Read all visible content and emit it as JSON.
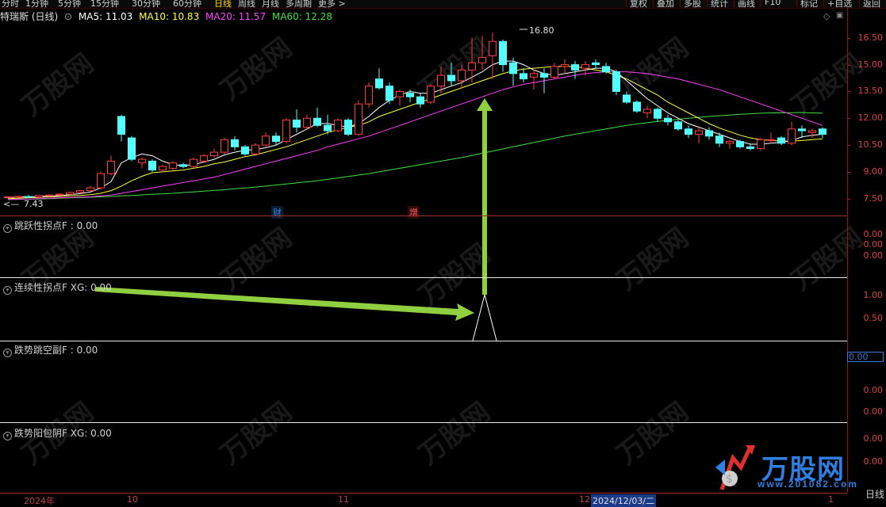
{
  "toolbar": {
    "periods": [
      "分时",
      "1分钟",
      "5分钟",
      "15分钟",
      "30分钟",
      "60分钟",
      "日线",
      "周线",
      "月线",
      "多周期",
      "更多 >"
    ],
    "active_period": "日线",
    "right_buttons": [
      "复权",
      "叠加",
      "多股",
      "统计",
      "画线",
      "F10",
      "标记",
      "+自选",
      "返回"
    ]
  },
  "header": {
    "stock": "特瑞斯 (日线)",
    "ma5": "MA5: 11.03",
    "ma10": "MA10: 10.83",
    "ma20": "MA20: 11.57",
    "ma60": "MA60: 12.28",
    "colors": {
      "ma5": "#ffffff",
      "ma10": "#ffff40",
      "ma20": "#ff40ff",
      "ma60": "#40e040"
    }
  },
  "main_chart": {
    "y_ticks": [
      "16.50",
      "15.00",
      "13.50",
      "12.00",
      "10.50",
      "9.00",
      "7.50"
    ],
    "high_marker": "16.80",
    "low_marker": "7.43",
    "badges": {
      "cai": "财",
      "zeng": "增"
    }
  },
  "panels": [
    {
      "label": "跳跃性拐点F : 0.00",
      "ticks": [
        "0.00",
        "0.00",
        "0.00"
      ]
    },
    {
      "label": "连续性拐点F XG: 0.00",
      "ticks": [
        "1.00",
        "0.50"
      ]
    },
    {
      "label": "跌势跳空副F : 0.00",
      "ticks": [
        "0.00",
        "0.00"
      ],
      "value_box": "0.00"
    },
    {
      "label": "跌势阳包阴F XG: 0.00",
      "ticks": [
        "0.00",
        "0.00"
      ]
    }
  ],
  "x_axis": {
    "labels": [
      "2024年",
      "10",
      "11",
      "12",
      "2024/12/03/二",
      "1"
    ]
  },
  "bottom_tab": "日线",
  "logo": {
    "text": "万股网",
    "url": "www.201082.com"
  },
  "colors": {
    "up": "#ff3c3c",
    "down": "#54ffff",
    "grid_red": "#a03030",
    "arrow": "#90d040"
  },
  "chart_data": {
    "type": "candlestick",
    "candles": [
      [
        7.6,
        7.6,
        7.5,
        7.6
      ],
      [
        7.6,
        7.65,
        7.55,
        7.62
      ],
      [
        7.62,
        7.7,
        7.55,
        7.6
      ],
      [
        7.6,
        7.7,
        7.55,
        7.68
      ],
      [
        7.68,
        7.75,
        7.6,
        7.7
      ],
      [
        7.7,
        7.8,
        7.65,
        7.75
      ],
      [
        7.75,
        7.9,
        7.7,
        7.85
      ],
      [
        7.85,
        8.0,
        7.8,
        7.95
      ],
      [
        7.95,
        8.2,
        7.9,
        8.1
      ],
      [
        8.1,
        9.0,
        8.0,
        8.9
      ],
      [
        8.9,
        9.9,
        8.8,
        9.6
      ],
      [
        12.1,
        12.2,
        10.7,
        11.1
      ],
      [
        10.9,
        11.0,
        9.6,
        9.7
      ],
      [
        9.5,
        9.8,
        9.2,
        9.7
      ],
      [
        9.6,
        9.7,
        9.0,
        9.1
      ],
      [
        9.1,
        9.4,
        9.0,
        9.3
      ],
      [
        9.2,
        9.6,
        9.1,
        9.5
      ],
      [
        9.4,
        9.5,
        9.2,
        9.3
      ],
      [
        9.3,
        9.8,
        9.2,
        9.7
      ],
      [
        9.6,
        10.0,
        9.5,
        9.9
      ],
      [
        9.9,
        10.3,
        9.8,
        10.1
      ],
      [
        10.1,
        10.9,
        10.0,
        10.8
      ],
      [
        10.8,
        11.0,
        10.2,
        10.4
      ],
      [
        10.4,
        10.5,
        9.9,
        10.0
      ],
      [
        10.0,
        10.6,
        9.9,
        10.5
      ],
      [
        10.5,
        11.2,
        10.4,
        11.0
      ],
      [
        11.0,
        11.2,
        10.5,
        10.7
      ],
      [
        10.7,
        12.0,
        10.6,
        11.9
      ],
      [
        11.9,
        12.5,
        11.2,
        11.5
      ],
      [
        11.5,
        12.2,
        11.4,
        12.0
      ],
      [
        12.0,
        12.6,
        11.5,
        11.6
      ],
      [
        11.6,
        12.2,
        11.1,
        11.3
      ],
      [
        11.3,
        12.0,
        11.2,
        11.9
      ],
      [
        11.9,
        12.0,
        11.0,
        11.1
      ],
      [
        11.1,
        13.0,
        11.0,
        12.8
      ],
      [
        12.8,
        14.0,
        12.6,
        13.8
      ],
      [
        14.2,
        14.8,
        13.6,
        13.7
      ],
      [
        13.8,
        14.0,
        12.8,
        13.0
      ],
      [
        13.2,
        13.6,
        12.7,
        13.5
      ],
      [
        13.4,
        13.6,
        12.9,
        13.2
      ],
      [
        13.2,
        13.4,
        12.6,
        12.8
      ],
      [
        12.9,
        13.9,
        12.8,
        13.8
      ],
      [
        13.8,
        14.9,
        13.4,
        14.4
      ],
      [
        14.4,
        15.1,
        13.8,
        14.1
      ],
      [
        14.1,
        15.0,
        13.7,
        14.7
      ],
      [
        14.7,
        16.5,
        14.0,
        15.1
      ],
      [
        15.1,
        16.6,
        14.7,
        15.4
      ],
      [
        15.5,
        16.8,
        14.2,
        16.3
      ],
      [
        16.3,
        16.4,
        14.6,
        15.0
      ],
      [
        15.1,
        15.4,
        13.8,
        14.5
      ],
      [
        14.5,
        14.8,
        14.0,
        14.2
      ],
      [
        14.3,
        14.7,
        13.6,
        14.5
      ],
      [
        14.5,
        14.8,
        13.4,
        14.3
      ],
      [
        14.3,
        15.1,
        14.2,
        14.9
      ],
      [
        14.9,
        15.3,
        14.5,
        15.0
      ],
      [
        15.0,
        15.2,
        14.2,
        14.7
      ],
      [
        14.8,
        15.2,
        14.4,
        15.0
      ],
      [
        15.1,
        15.3,
        14.8,
        15.0
      ],
      [
        14.9,
        15.1,
        14.5,
        14.6
      ],
      [
        14.6,
        14.7,
        13.3,
        13.5
      ],
      [
        13.3,
        13.5,
        12.8,
        12.9
      ],
      [
        12.9,
        13.0,
        12.3,
        12.4
      ],
      [
        12.3,
        12.7,
        12.0,
        12.5
      ],
      [
        12.5,
        12.6,
        11.8,
        12.0
      ],
      [
        12.0,
        12.2,
        11.6,
        11.8
      ],
      [
        11.8,
        11.9,
        11.3,
        11.4
      ],
      [
        11.4,
        11.6,
        10.9,
        11.1
      ],
      [
        11.1,
        11.5,
        10.6,
        11.3
      ],
      [
        11.3,
        11.5,
        10.8,
        11.0
      ],
      [
        11.0,
        11.2,
        10.4,
        10.6
      ],
      [
        10.6,
        10.8,
        10.3,
        10.7
      ],
      [
        10.7,
        10.8,
        10.3,
        10.4
      ],
      [
        10.4,
        10.6,
        10.2,
        10.3
      ],
      [
        10.3,
        10.9,
        10.2,
        10.8
      ],
      [
        10.8,
        11.2,
        10.6,
        10.8
      ],
      [
        10.9,
        11.0,
        10.5,
        10.6
      ],
      [
        10.6,
        11.8,
        10.5,
        11.4
      ],
      [
        11.4,
        11.6,
        10.9,
        11.3
      ],
      [
        11.2,
        11.4,
        10.9,
        11.3
      ],
      [
        11.4,
        11.5,
        10.9,
        11.1
      ]
    ],
    "ma5": [
      7.55,
      7.6,
      7.6,
      7.62,
      7.64,
      7.67,
      7.72,
      7.78,
      7.87,
      8.1,
      8.45,
      9.5,
      9.8,
      10.0,
      9.9,
      9.6,
      9.4,
      9.35,
      9.4,
      9.55,
      9.7,
      9.95,
      10.1,
      10.2,
      10.25,
      10.35,
      10.5,
      10.8,
      11.1,
      11.4,
      11.7,
      11.7,
      11.6,
      11.5,
      11.7,
      12.1,
      12.6,
      13.0,
      13.3,
      13.5,
      13.4,
      13.4,
      13.6,
      13.8,
      14.0,
      14.3,
      14.6,
      15.0,
      15.2,
      15.2,
      15.0,
      14.7,
      14.5,
      14.4,
      14.5,
      14.6,
      14.7,
      14.8,
      14.8,
      14.6,
      14.1,
      13.6,
      13.1,
      12.7,
      12.3,
      12.0,
      11.7,
      11.5,
      11.3,
      11.1,
      10.9,
      10.7,
      10.55,
      10.55,
      10.6,
      10.65,
      10.75,
      10.95,
      11.05,
      11.1
    ],
    "ma10": [
      7.5,
      7.52,
      7.55,
      7.57,
      7.6,
      7.62,
      7.65,
      7.68,
      7.72,
      7.8,
      7.95,
      8.2,
      8.5,
      8.75,
      8.95,
      9.0,
      9.05,
      9.1,
      9.2,
      9.3,
      9.45,
      9.55,
      9.7,
      9.85,
      9.95,
      10.1,
      10.25,
      10.4,
      10.6,
      10.8,
      11.0,
      11.2,
      11.35,
      11.5,
      11.6,
      11.8,
      12.1,
      12.3,
      12.5,
      12.7,
      12.9,
      13.1,
      13.3,
      13.5,
      13.7,
      13.9,
      14.1,
      14.3,
      14.5,
      14.65,
      14.75,
      14.8,
      14.85,
      14.9,
      14.9,
      14.9,
      14.8,
      14.7,
      14.6,
      14.4,
      14.2,
      13.9,
      13.6,
      13.3,
      12.9,
      12.6,
      12.3,
      12.0,
      11.7,
      11.45,
      11.25,
      11.05,
      10.9,
      10.8,
      10.75,
      10.72,
      10.72,
      10.75,
      10.8,
      10.85
    ],
    "ma20": [
      7.45,
      7.47,
      7.48,
      7.5,
      7.52,
      7.54,
      7.56,
      7.58,
      7.6,
      7.65,
      7.7,
      7.8,
      7.9,
      8.0,
      8.1,
      8.2,
      8.3,
      8.4,
      8.5,
      8.6,
      8.7,
      8.85,
      9.0,
      9.15,
      9.3,
      9.45,
      9.6,
      9.75,
      9.9,
      10.05,
      10.2,
      10.4,
      10.55,
      10.7,
      10.85,
      11.0,
      11.2,
      11.4,
      11.6,
      11.8,
      12.0,
      12.2,
      12.4,
      12.6,
      12.8,
      13.0,
      13.2,
      13.4,
      13.6,
      13.75,
      13.9,
      14.0,
      14.1,
      14.2,
      14.3,
      14.4,
      14.5,
      14.55,
      14.6,
      14.6,
      14.6,
      14.55,
      14.5,
      14.4,
      14.3,
      14.2,
      14.05,
      13.9,
      13.75,
      13.6,
      13.4,
      13.2,
      13.0,
      12.8,
      12.6,
      12.4,
      12.2,
      12.0,
      11.8,
      11.6
    ],
    "ma60": [
      7.45,
      7.46,
      7.47,
      7.48,
      7.5,
      7.52,
      7.54,
      7.56,
      7.58,
      7.6,
      7.62,
      7.65,
      7.68,
      7.71,
      7.74,
      7.77,
      7.8,
      7.84,
      7.88,
      7.92,
      7.96,
      8.0,
      8.05,
      8.1,
      8.15,
      8.2,
      8.26,
      8.32,
      8.38,
      8.44,
      8.5,
      8.58,
      8.66,
      8.74,
      8.82,
      8.9,
      9.0,
      9.1,
      9.2,
      9.3,
      9.4,
      9.5,
      9.6,
      9.7,
      9.8,
      9.92,
      10.04,
      10.16,
      10.28,
      10.4,
      10.52,
      10.64,
      10.76,
      10.88,
      11.0,
      11.1,
      11.2,
      11.3,
      11.4,
      11.5,
      11.6,
      11.68,
      11.75,
      11.82,
      11.88,
      11.94,
      12.0,
      12.05,
      12.1,
      12.14,
      12.18,
      12.22,
      12.25,
      12.28,
      12.3,
      12.3,
      12.31,
      12.32,
      12.3,
      12.28
    ],
    "y_range": [
      7.0,
      17.2
    ]
  }
}
